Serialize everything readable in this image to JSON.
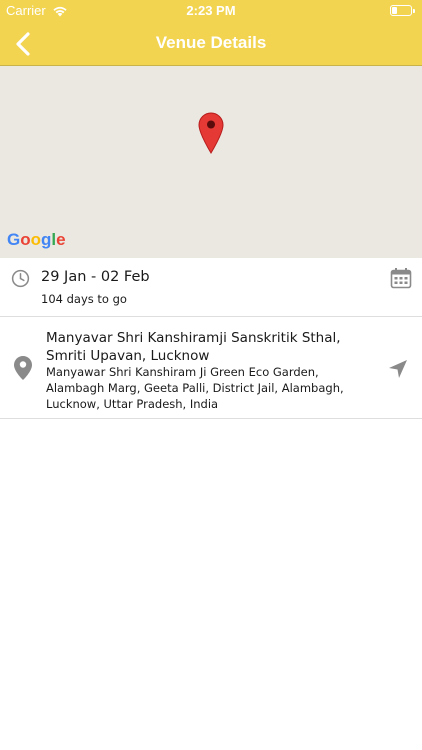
{
  "status_bar": {
    "carrier": "Carrier",
    "time": "2:23 PM"
  },
  "nav": {
    "title": "Venue Details",
    "back_icon": "chevron-left-icon"
  },
  "map": {
    "logo_letters": [
      "G",
      "o",
      "o",
      "g",
      "l",
      "e"
    ],
    "logo_colors": [
      "#4285F4",
      "#EA4335",
      "#FBBC05",
      "#4285F4",
      "#34A853",
      "#EA4335"
    ],
    "pin_color": "#E53935"
  },
  "event": {
    "date_range": "29 Jan - 02 Feb",
    "days_to_go": "104 days to go"
  },
  "venue": {
    "name": "Manyavar Shri Kanshiramji Sanskritik Sthal, Smriti Upavan, Lucknow",
    "address": "Manyawar Shri Kanshiram Ji Green Eco Garden, Alambagh Marg, Geeta Palli, District Jail, Alambagh, Lucknow, Uttar Pradesh, India"
  },
  "colors": {
    "header": "#F2D451",
    "map_background": "#EBE8E1",
    "icon_gray": "#8a8a8a"
  }
}
